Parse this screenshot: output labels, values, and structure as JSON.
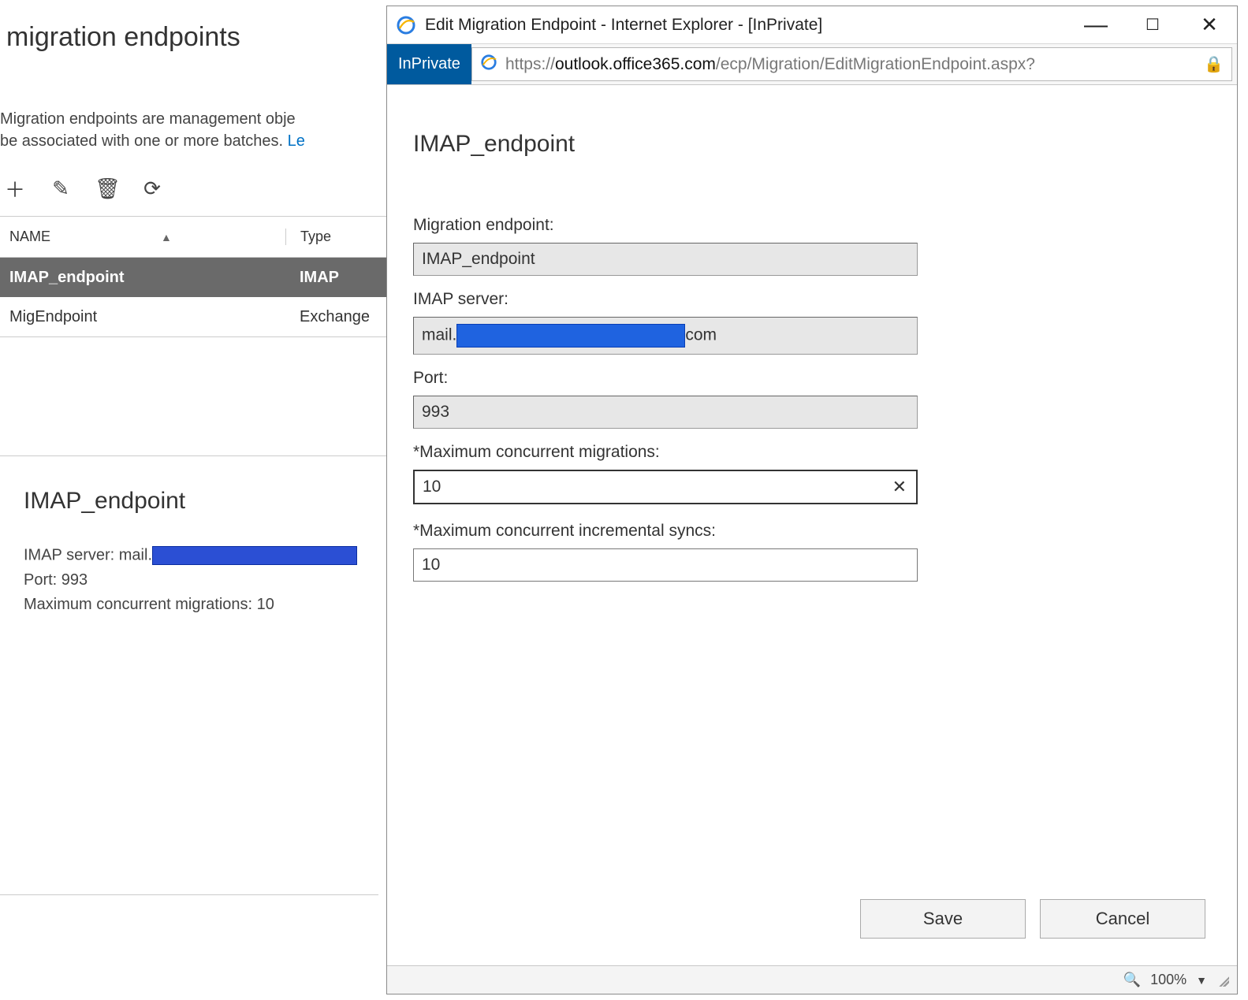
{
  "bg": {
    "title": "migration endpoints",
    "desc_prefix": "Migration endpoints are management obje",
    "desc_line2_prefix": "be associated with one or more batches. ",
    "learn_link": "Le",
    "table": {
      "col_name": "NAME",
      "col_type": "Type",
      "rows": [
        {
          "name": "IMAP_endpoint",
          "type": "IMAP",
          "selected": true
        },
        {
          "name": "MigEndpoint",
          "type": "Exchange",
          "selected": false
        }
      ]
    },
    "details": {
      "title": "IMAP_endpoint",
      "server_label": "IMAP server: mail.",
      "port": "Port: 993",
      "max": "Maximum concurrent migrations: 10"
    }
  },
  "popup": {
    "window_title": "Edit Migration Endpoint - Internet Explorer - [InPrivate]",
    "inprivate_badge": "InPrivate",
    "url_scheme": "https://",
    "url_host": "outlook.office365.com",
    "url_path": "/ecp/Migration/EditMigrationEndpoint.aspx?",
    "heading": "IMAP_endpoint",
    "fields": {
      "endpoint_label": "Migration endpoint:",
      "endpoint_value": "IMAP_endpoint",
      "imap_label": "IMAP server:",
      "imap_prefix": "mail.",
      "imap_suffix": "com",
      "port_label": "Port:",
      "port_value": "993",
      "max_mig_label": "*Maximum concurrent migrations:",
      "max_mig_value": "10",
      "max_sync_label": "*Maximum concurrent incremental syncs:",
      "max_sync_value": "10"
    },
    "buttons": {
      "save": "Save",
      "cancel": "Cancel"
    },
    "status": {
      "zoom": "100%"
    }
  }
}
